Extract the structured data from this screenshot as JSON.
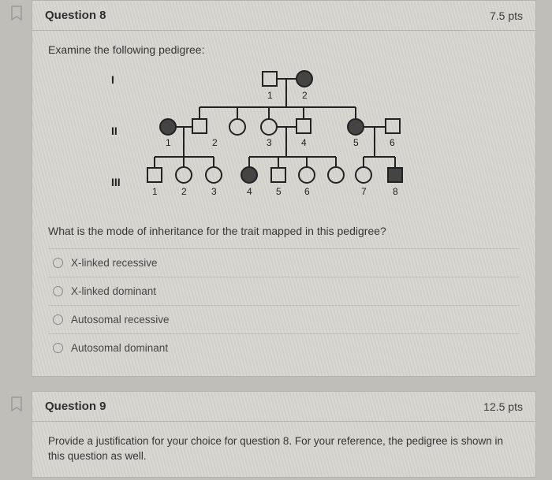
{
  "q8": {
    "title": "Question 8",
    "points": "7.5 pts",
    "prompt": "Examine the following pedigree:",
    "question": "What is the mode of inheritance for the trait mapped in this pedigree?",
    "options": [
      "X-linked recessive",
      "X-linked dominant",
      "Autosomal recessive",
      "Autosomal dominant"
    ],
    "gen_labels": {
      "g1": "I",
      "g2": "II",
      "g3": "III"
    },
    "nums": {
      "i1": "1",
      "i2": "2",
      "ii1": "1",
      "ii2": "2",
      "ii3": "3",
      "ii4": "4",
      "ii5": "5",
      "ii6": "6",
      "iii1": "1",
      "iii2": "2",
      "iii3": "3",
      "iii4": "4",
      "iii5": "5",
      "iii6": "6",
      "iii7": "7",
      "iii8": "8"
    }
  },
  "q9": {
    "title": "Question 9",
    "points": "12.5 pts",
    "body": "Provide a justification for your choice for question 8. For your reference, the pedigree is shown in this question as well."
  }
}
